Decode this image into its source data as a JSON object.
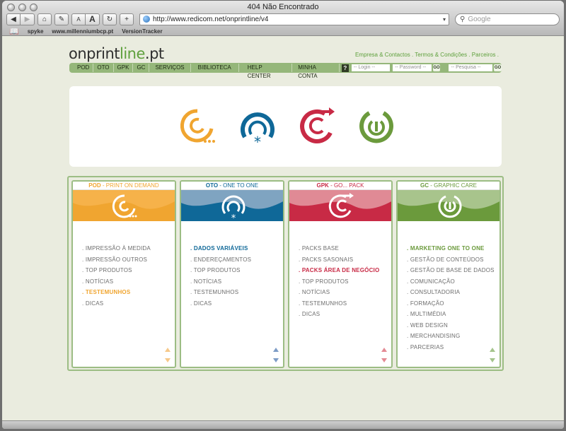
{
  "browser": {
    "window_title": "404 Não Encontrado",
    "url": "http://www.redicom.net/onprintline/v4",
    "search_placeholder": "Google",
    "font_small": "A",
    "font_large": "A",
    "bookmarks": [
      "spyke",
      "www.millenniumbcp.pt",
      "VersionTracker"
    ]
  },
  "logo": {
    "part1": "onprint",
    "part2": "line",
    "part3": ".pt"
  },
  "toplinks": "Empresa & Contactos . Termos & Condições . Parceiros .",
  "nav": {
    "items": [
      "POD",
      "OTO",
      "GPK",
      "GC",
      "SERVIÇOS",
      "BIBLIOTECA",
      "HELP CENTER",
      "MINHA CONTA"
    ],
    "help": "?",
    "login_placeholder": "-- Login --",
    "password_placeholder": "-- Password --",
    "search_placeholder": "-- Pesquisa --",
    "go": "GO"
  },
  "colors": {
    "pod": "#f0a530",
    "oto": "#0f6898",
    "gpk": "#c82a45",
    "gc": "#6b9a3c",
    "frame": "#9cbd84"
  },
  "icons": [
    "pod-logo-icon",
    "oto-logo-icon",
    "gpk-logo-icon",
    "gc-logo-icon"
  ],
  "cards": [
    {
      "code": "POD",
      "title": " - PRINT ON DEMAND",
      "items": [
        ". IMPRESSÃO À MEDIDA",
        ". IMPRESSÃO OUTROS",
        ". TOP PRODUTOS",
        ". NOTÍCIAS",
        ". TESTEMUNHOS",
        ". DICAS"
      ],
      "highlight": 4
    },
    {
      "code": "OTO",
      "title": " - ONE TO ONE",
      "items": [
        ". DADOS VARIÁVEIS",
        ". ENDEREÇAMENTOS",
        ". TOP PRODUTOS",
        ". NOTÍCIAS",
        ". TESTEMUNHOS",
        ". DICAS"
      ],
      "highlight": 0
    },
    {
      "code": "GPK",
      "title": " - GO... PACK",
      "items": [
        ". PACKS BASE",
        ". PACKS SASONAIS",
        ". PACKS ÁREA DE NEGÓCIO",
        ". TOP PRODUTOS",
        ". NOTÍCIAS",
        ". TESTEMUNHOS",
        ". DICAS"
      ],
      "highlight": 2
    },
    {
      "code": "GC",
      "title": " - GRAPHIC CARE",
      "items": [
        ". MARKETING ONE TO ONE",
        ". GESTÃO DE CONTEÚDOS",
        ". GESTÃO DE BASE DE DADOS",
        ". COMUNICAÇÃO",
        ". CONSULTADORIA",
        ". FORMAÇÃO",
        ". MULTIMÉDIA",
        ". WEB DESIGN",
        ". MERCHANDISING",
        ". PARCERIAS"
      ],
      "highlight": 0
    }
  ]
}
